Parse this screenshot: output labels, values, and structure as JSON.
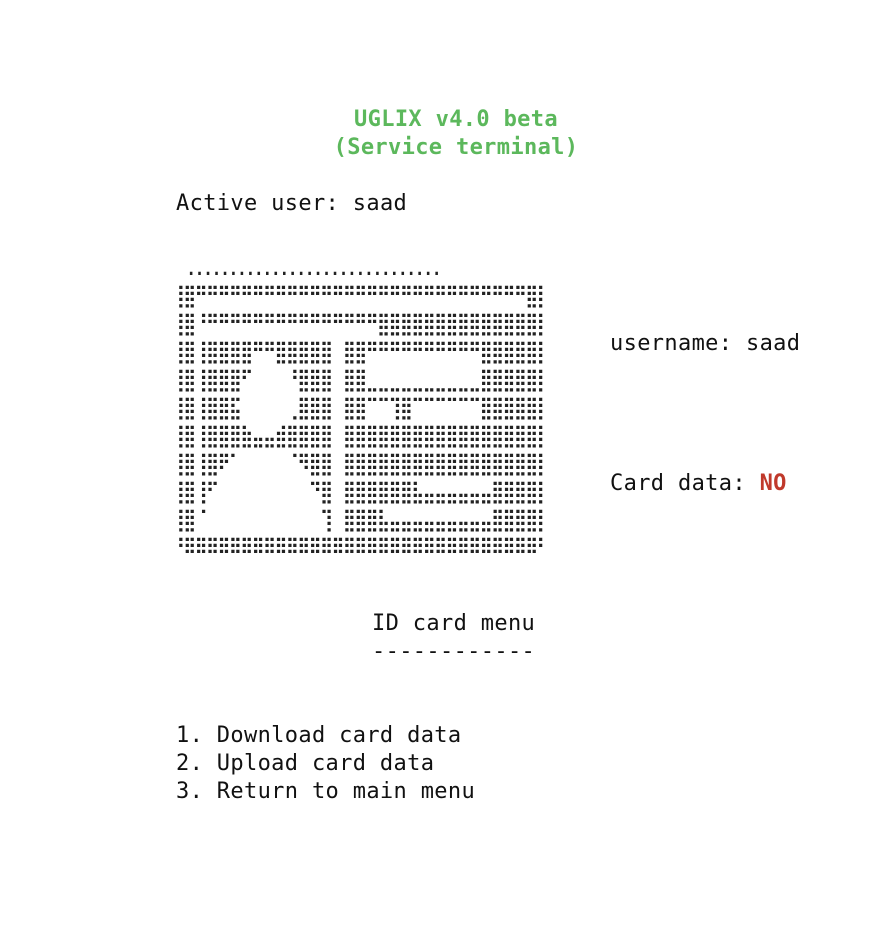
{
  "header": {
    "title_line_1": "UGLIX v4.0 beta",
    "title_line_2": "(Service terminal)"
  },
  "session": {
    "active_user_label": "Active user:",
    "active_user": "saad"
  },
  "id_card": {
    "art_lines": [
      " .............................. ",
      "⣿⡟⠛⠛⠛⠛⠛⠛⠛⠛⠛⠛⠛⠛⠛⠛⠛⠛⠛⠛⠛⠛⠛⠛⠛⠛⠛⠛⠛⠛⢻⣿",
      "⣿⡇⠛⠛⠛⠛⠛⠛⠛⠛⠛⠛⠛⠛⠛⠛⠛⢻⣿⣿⣿⣿⣿⣿⣿⣿⣿⣿⣿⣿⣿⣿",
      "⣿⡇⣿⣿⣿⣿⡟⠛⢻⣿⣿⣿⣿⡇⢸⣿⡟⠛⠛⠛⠛⠛⠛⠛⠛⠛⢻⣿⣿⣿⣿⣿",
      "⣿⡇⣿⣿⣿⡟⠁⠀⠀⠀⢻⣿⣿⡇⢸⣿⣇⣀⣀⣀⣀⣀⣀⣀⣀⣀⣸⣿⣿⣿⣿⣿",
      "⣿⡇⣿⣿⣿⡅⠀⠀⠀⠀⣸⣿⣿⡇⢸⣿⡏⠉⠉⣿⡏⠉⠉⠉⠉⠉⢹⣿⣿⣿⣿⣿",
      "⣿⡇⣿⣿⣿⣿⣦⣤⣴⣿⣿⣿⣿⡇⢸⣿⣿⣿⣿⣿⣿⣿⣿⣿⣿⣿⣿⣿⣿⣿⣿⣿",
      "⣿⡇⣿⡿⠋⠀⠀⠀⠀⠀⠙⢿⣿⡇⢸⣿⣿⣿⣿⣿⣿⣿⣿⣿⣿⣿⣿⣿⣿⣿⣿⣿",
      "⣿⡇⡟⠁⠀⠀⠀⠀⠀⠀⠀⠈⢻⡇⢸⣿⣿⣿⣿⣿⣿⣤⣤⣤⣤⣤⣤⣼⣿⣿⣿⣿",
      "⣿⡇⠁⠀⠀⠀⠀⠀⠀⠀⠀⠀⠈⡇⢸⣿⣿⣿⣤⣤⣤⣤⣤⣤⣤⣤⣤⣼⣿⣿⣿⣿",
      "⠻⠿⠿⠿⠿⠿⠿⠿⠿⠿⠿⠿⠿⠿⠿⠿⠿⠿⠿⠿⠿⠿⠿⠿⠿⠿⠿⠿⠿⠿⠿⠟"
    ],
    "username_label": "username:",
    "username": "saad",
    "card_data_label": "Card data:",
    "card_data_status": "NO"
  },
  "menu": {
    "title": "ID card menu",
    "underline": "------------",
    "items": [
      "1. Download card data",
      "2. Upload card data",
      "3. Return to main menu"
    ]
  },
  "colors": {
    "title": "#5cb85c",
    "status_no": "#c0392b",
    "text": "#111111",
    "background": "#ffffff"
  }
}
